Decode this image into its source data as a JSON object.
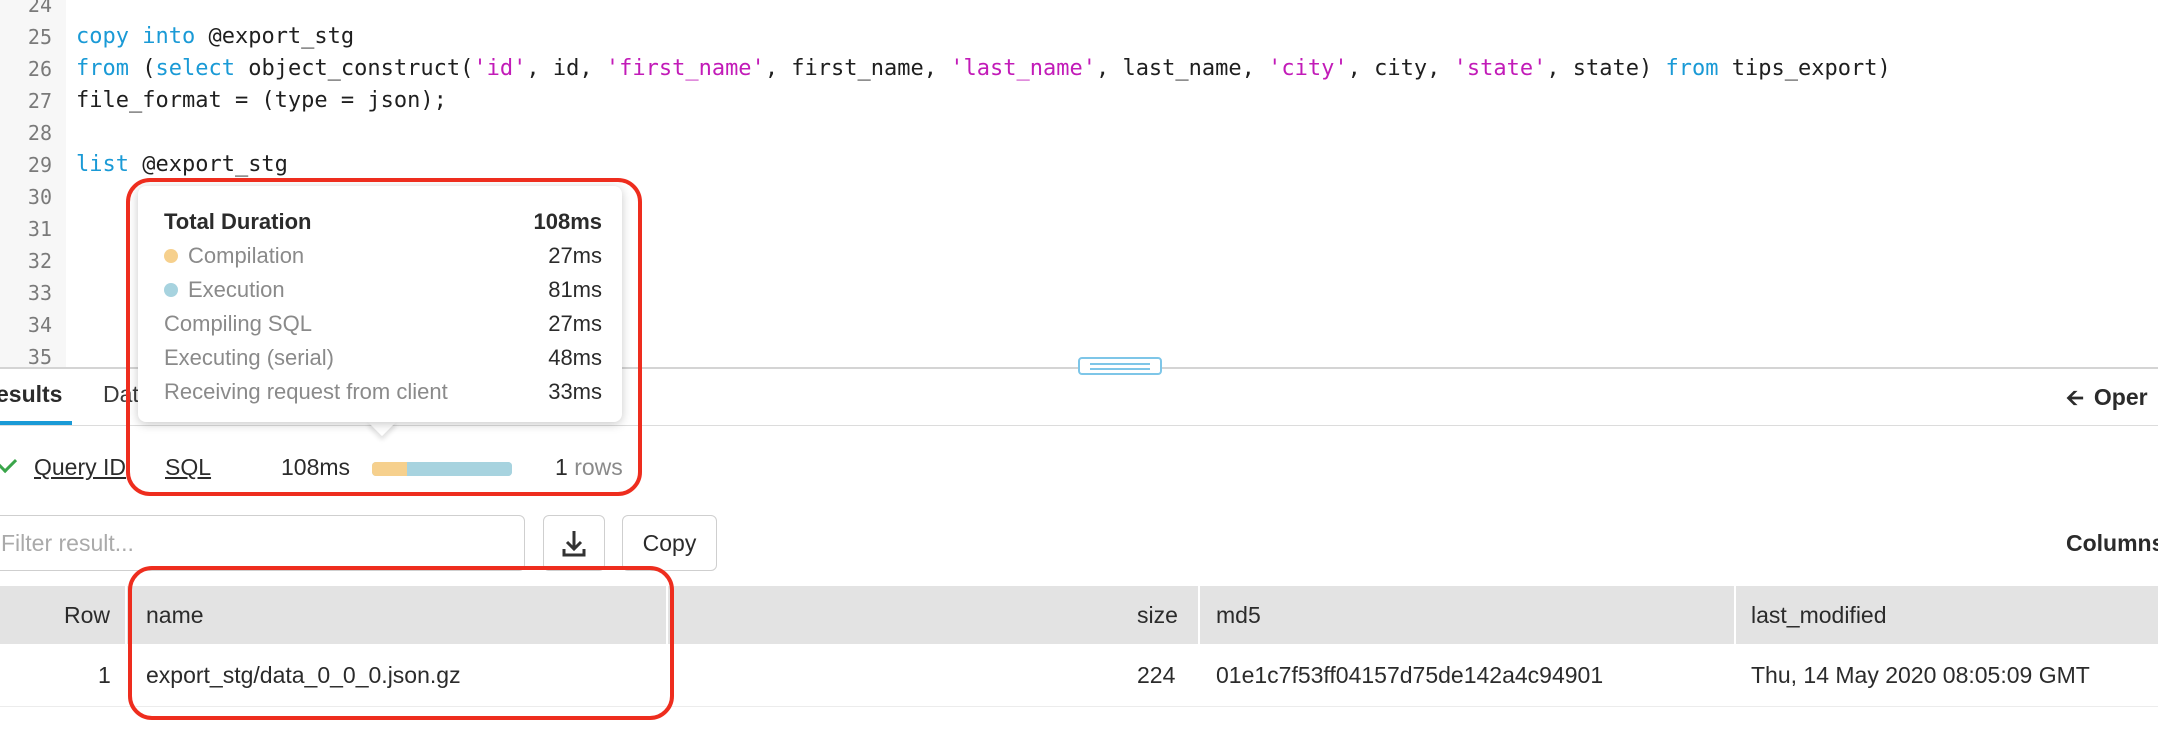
{
  "editor": {
    "lines": [
      {
        "num": "24",
        "tokens": []
      },
      {
        "num": "25",
        "tokens": [
          {
            "t": "kw",
            "v": "copy"
          },
          {
            "t": "p",
            "v": " "
          },
          {
            "t": "kw",
            "v": "into"
          },
          {
            "t": "p",
            "v": " @export_stg"
          }
        ]
      },
      {
        "num": "26",
        "tokens": [
          {
            "t": "kw",
            "v": "from"
          },
          {
            "t": "p",
            "v": " ("
          },
          {
            "t": "kw",
            "v": "select"
          },
          {
            "t": "p",
            "v": " object_construct("
          },
          {
            "t": "str",
            "v": "'id'"
          },
          {
            "t": "p",
            "v": ", id, "
          },
          {
            "t": "str",
            "v": "'first_name'"
          },
          {
            "t": "p",
            "v": ", first_name, "
          },
          {
            "t": "str",
            "v": "'last_name'"
          },
          {
            "t": "p",
            "v": ", last_name, "
          },
          {
            "t": "str",
            "v": "'city'"
          },
          {
            "t": "p",
            "v": ", city, "
          },
          {
            "t": "str",
            "v": "'state'"
          },
          {
            "t": "p",
            "v": ", state) "
          },
          {
            "t": "kw",
            "v": "from"
          },
          {
            "t": "p",
            "v": " tips_export)"
          }
        ]
      },
      {
        "num": "27",
        "tokens": [
          {
            "t": "p",
            "v": "file_format = (type = json);"
          }
        ]
      },
      {
        "num": "28",
        "tokens": []
      },
      {
        "num": "29",
        "tokens": [
          {
            "t": "kw",
            "v": "list"
          },
          {
            "t": "p",
            "v": " @export_stg"
          }
        ]
      },
      {
        "num": "30",
        "tokens": []
      },
      {
        "num": "31",
        "tokens": []
      },
      {
        "num": "32",
        "tokens": []
      },
      {
        "num": "33",
        "tokens": []
      },
      {
        "num": "34",
        "tokens": []
      },
      {
        "num": "35",
        "tokens": []
      }
    ]
  },
  "tabs": {
    "results": "esults",
    "data": "Data",
    "open": "Oper"
  },
  "query": {
    "id_label": "Query ID",
    "sql_label": "SQL",
    "duration": "108ms",
    "rows_count": "1",
    "rows_label": "rows",
    "compilation_share": 0.25,
    "execution_share": 0.75
  },
  "tooltip": {
    "total_label": "Total Duration",
    "total_value": "108ms",
    "compilation_label": "Compilation",
    "compilation_value": "27ms",
    "execution_label": "Execution",
    "execution_value": "81ms",
    "compiling_label": "Compiling SQL",
    "compiling_value": "27ms",
    "executing_label": "Executing (serial)",
    "executing_value": "48ms",
    "receiving_label": "Receiving request from client",
    "receiving_value": "33ms"
  },
  "toolbar": {
    "filter_placeholder": "Filter result...",
    "copy_label": "Copy",
    "columns_label": "Columns"
  },
  "table": {
    "headers": {
      "row": "Row",
      "name": "name",
      "size": "size",
      "md5": "md5",
      "last_modified": "last_modified"
    },
    "rows": [
      {
        "row": "1",
        "name": "export_stg/data_0_0_0.json.gz",
        "size": "224",
        "md5": "01e1c7f53ff04157d75de142a4c94901",
        "last_modified": "Thu, 14 May 2020 08:05:09 GMT"
      }
    ]
  },
  "colors": {
    "keyword": "#1a9ad6",
    "string": "#c21bb8",
    "compilation": "#f6d08d",
    "execution": "#a7d3df",
    "annotation": "#ee2d1e"
  }
}
